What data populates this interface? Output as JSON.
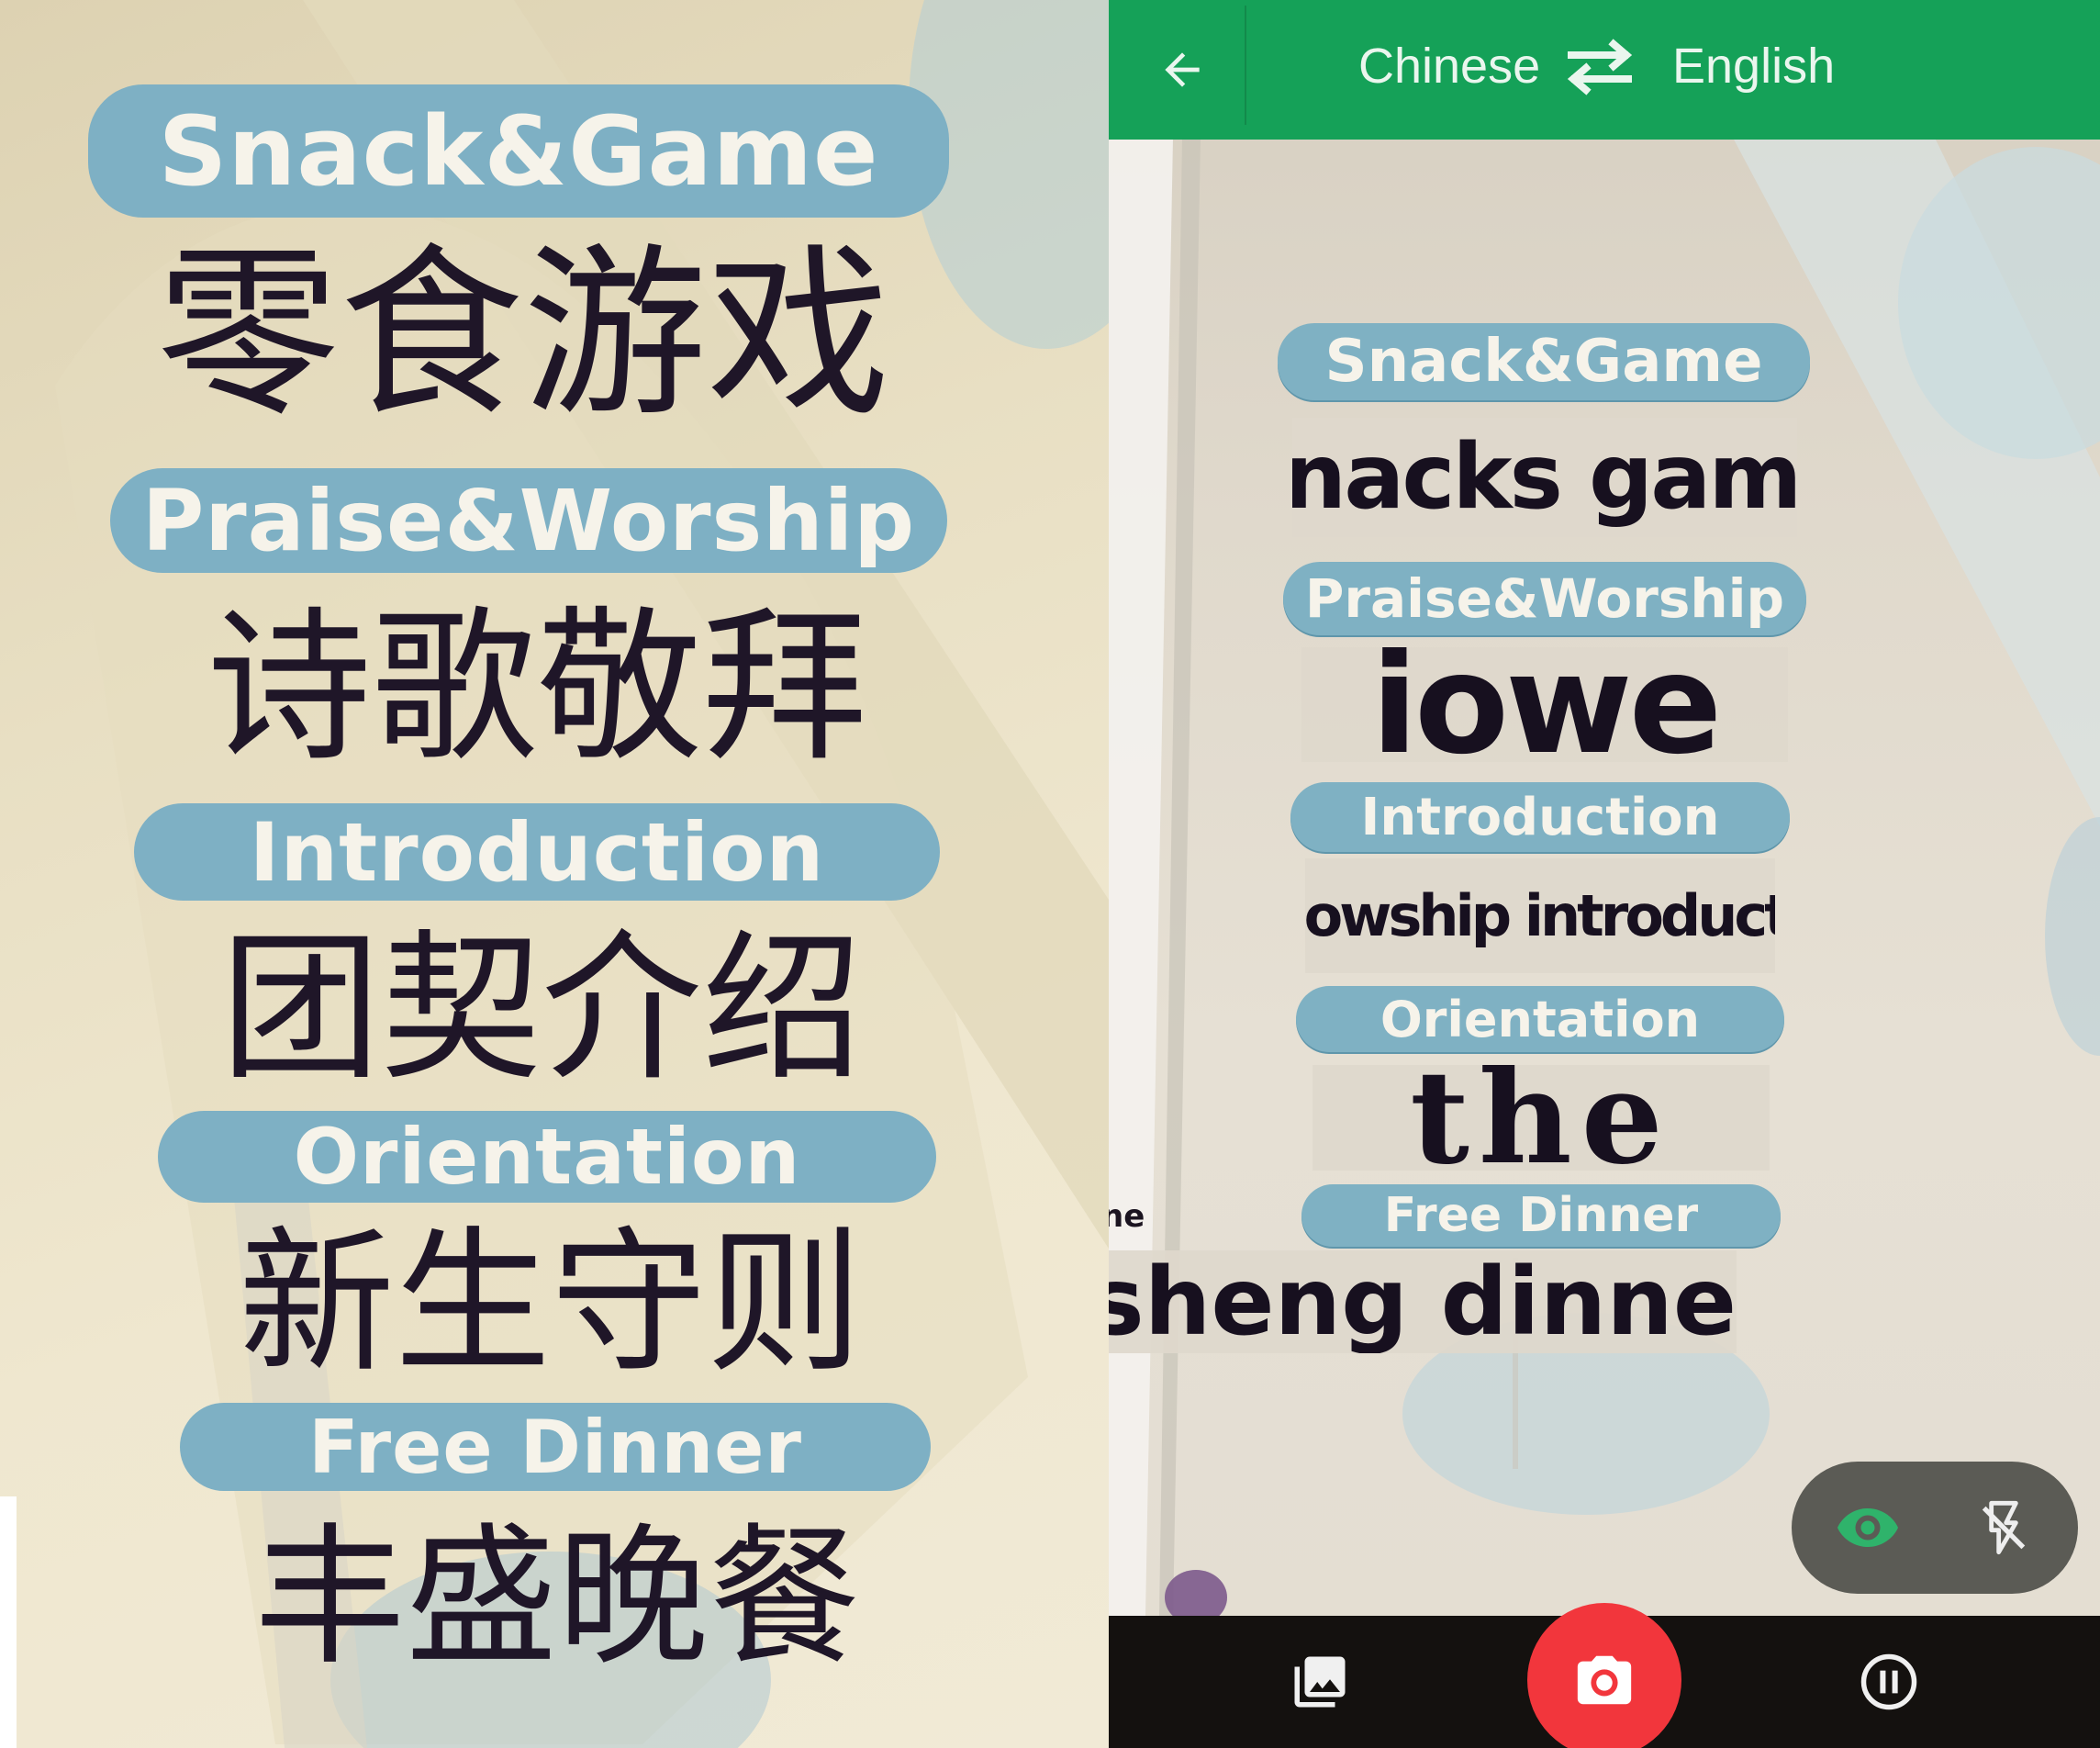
{
  "poster": {
    "sections": [
      {
        "en": "Snack&Game",
        "cn": "零食游戏"
      },
      {
        "en": "Praise&Worship",
        "cn": "诗歌敬拜"
      },
      {
        "en": "Introduction",
        "cn": "团契介绍"
      },
      {
        "en": "Orientation",
        "cn": "新生守则"
      },
      {
        "en": "Free Dinner",
        "cn": "丰盛晚餐"
      }
    ]
  },
  "translate_app": {
    "source_language": "Chinese",
    "target_language": "English",
    "overlay": [
      {
        "label": "Snack&Game",
        "translation": "snacks game"
      },
      {
        "label": "Praise&Worship",
        "translation": "iowe"
      },
      {
        "label": "Introduction",
        "translation": "Fellowship introduction"
      },
      {
        "label": "Orientation",
        "translation": "the"
      },
      {
        "label": "Free Dinner",
        "translation": "sheng dinner"
      }
    ],
    "stray_text": "ne",
    "colors": {
      "app_bar": "#15a158",
      "shutter": "#f2363c",
      "eye_icon": "#2fb36b"
    },
    "icons": [
      "back-arrow-icon",
      "swap-languages-icon",
      "eye-icon",
      "flash-off-icon",
      "gallery-icon",
      "camera-icon",
      "pause-icon"
    ]
  }
}
